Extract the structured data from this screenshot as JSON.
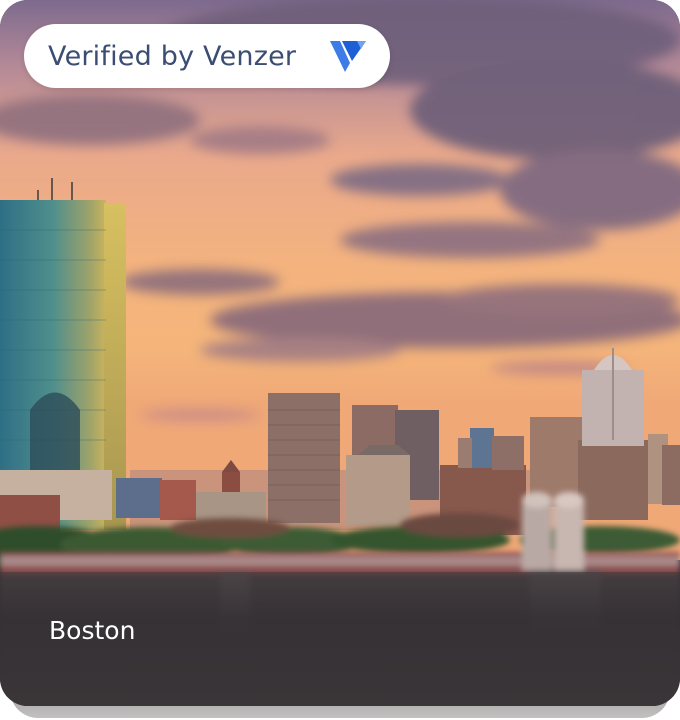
{
  "badge": {
    "text": "Verified by Venzer",
    "logo_icon": "venzer-logo-icon",
    "text_color": "#3b4d73",
    "logo_color": "#2f6be6"
  },
  "location": {
    "city": "Boston"
  },
  "photo": {
    "subject": "city-skyline-sunset"
  }
}
